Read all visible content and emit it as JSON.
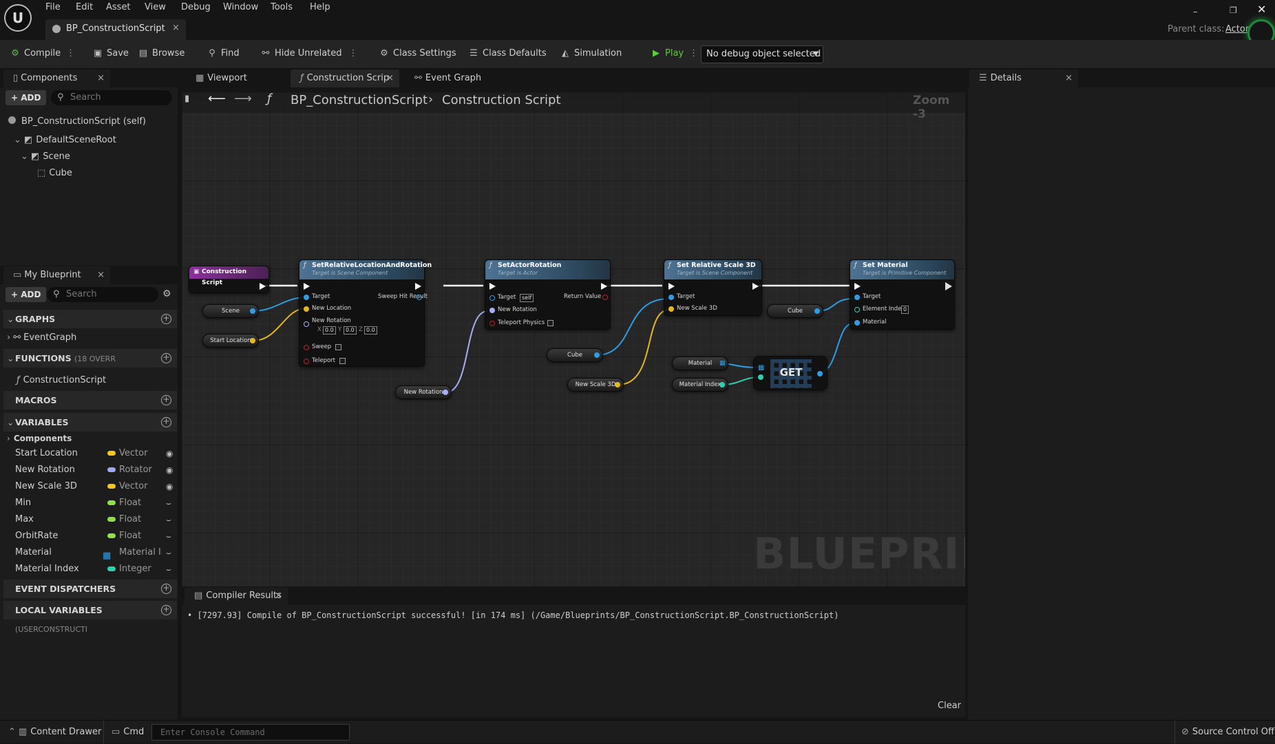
{
  "app": {
    "menu": [
      "File",
      "Edit",
      "Asset",
      "View",
      "Debug",
      "Window",
      "Tools",
      "Help"
    ],
    "document_tab": "BP_ConstructionScript",
    "parent_class_label": "Parent class:",
    "parent_class_value": "Actor"
  },
  "toolbar": {
    "compile": "Compile",
    "save": "Save",
    "browse": "Browse",
    "find": "Find",
    "hide_unrelated": "Hide Unrelated",
    "class_settings": "Class Settings",
    "class_defaults": "Class Defaults",
    "simulation": "Simulation",
    "play": "Play",
    "debug_object": "No debug object selected"
  },
  "components_panel": {
    "title": "Components",
    "add": "ADD",
    "search_placeholder": "Search",
    "items": [
      "BP_ConstructionScript (self)",
      "DefaultSceneRoot",
      "Scene",
      "Cube"
    ]
  },
  "my_blueprint": {
    "title": "My Blueprint",
    "add": "ADD",
    "search_placeholder": "Search",
    "graphs_label": "GRAPHS",
    "event_graph": "EventGraph",
    "functions_label": "FUNCTIONS",
    "functions_sub": "(18 OVERR",
    "construction_script": "ConstructionScript",
    "macros_label": "MACROS",
    "variables_label": "VARIABLES",
    "components_label": "Components",
    "variables": [
      {
        "name": "Start Location",
        "type": "Vector",
        "color": "#f5c518"
      },
      {
        "name": "New Rotation",
        "type": "Rotator",
        "color": "#a0a8f0"
      },
      {
        "name": "New Scale 3D",
        "type": "Vector",
        "color": "#f5c518"
      },
      {
        "name": "Min",
        "type": "Float",
        "color": "#8fe04a"
      },
      {
        "name": "Max",
        "type": "Float",
        "color": "#8fe04a"
      },
      {
        "name": "OrbitRate",
        "type": "Float",
        "color": "#8fe04a"
      },
      {
        "name": "Material",
        "type": "Material In",
        "color": "#3aa0e6"
      },
      {
        "name": "Material Index",
        "type": "Integer",
        "color": "#2fd0b0"
      }
    ],
    "event_dispatchers_label": "EVENT DISPATCHERS",
    "local_variables_label": "LOCAL VARIABLES",
    "local_variables_sub": "(USERCONSTRUCTI"
  },
  "graph_tabs": {
    "viewport": "Viewport",
    "construction": "Construction Scrip",
    "event_graph": "Event Graph"
  },
  "graph": {
    "breadcrumb_root": "BP_ConstructionScript",
    "breadcrumb_leaf": "Construction Script",
    "zoom": "Zoom -3",
    "watermark": "BLUEPRINT",
    "entry_node": "Construction Script",
    "node1": {
      "title": "SetRelativeLocationAndRotation",
      "sub": "Target is Scene Component",
      "target": "Target",
      "new_location": "New Location",
      "new_rotation": "New Rotation",
      "sweep": "Sweep",
      "teleport": "Teleport",
      "sweep_hit": "Sweep Hit Result",
      "x": "0.0",
      "y": "0.0",
      "z": "0.0"
    },
    "node2": {
      "title": "SetActorRotation",
      "sub": "Target is Actor",
      "target": "Target",
      "self": "self",
      "new_rotation": "New Rotation",
      "teleport": "Teleport Physics",
      "return": "Return Value"
    },
    "node3": {
      "title": "Set Relative Scale 3D",
      "sub": "Target is Scene Component",
      "target": "Target",
      "new_scale": "New Scale 3D"
    },
    "node4": {
      "title": "Set Material",
      "sub": "Target is Primitive Component",
      "target": "Target",
      "element_index": "Element Index",
      "element_value": "0",
      "material": "Material"
    },
    "get_node": "GET",
    "vars": {
      "scene": "Scene",
      "start_location": "Start Location",
      "new_rotation": "New Rotation",
      "cube1": "Cube",
      "new_scale": "New Scale 3D",
      "material": "Material",
      "material_index": "Material Index",
      "cube2": "Cube"
    }
  },
  "details": {
    "title": "Details"
  },
  "compiler": {
    "title": "Compiler Results",
    "message": "[7297.93] Compile of BP_ConstructionScript successful! [in 174 ms] (/Game/Blueprints/BP_ConstructionScript.BP_ConstructionScript)",
    "clear": "Clear"
  },
  "bottom": {
    "content_drawer": "Content Drawer",
    "cmd": "Cmd",
    "console_placeholder": "Enter Console Command",
    "source_control": "Source Control Off"
  }
}
